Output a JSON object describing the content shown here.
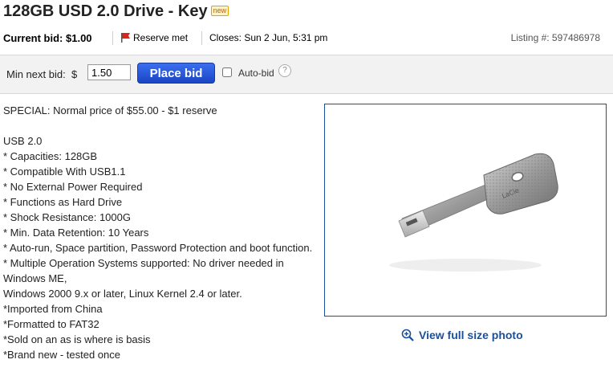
{
  "title": "128GB USD 2.0 Drive - Key",
  "new_badge": "new",
  "current_bid": "Current bid: $1.00",
  "reserve_status": "Reserve met",
  "closes": "Closes: Sun 2 Jun, 5:31 pm",
  "listing": "Listing #: 597486978",
  "bid_bar": {
    "min_next_bid_label": "Min next bid:",
    "currency": "$",
    "bid_value": "1.50",
    "place_bid_label": "Place bid",
    "autobid_label": "Auto-bid",
    "help_icon": "?"
  },
  "description": [
    "SPECIAL: Normal price of $55.00 - $1 reserve",
    "",
    "USB 2.0",
    "* Capacities: 128GB",
    "* Compatible With USB1.1",
    "* No External Power Required",
    "* Functions as Hard Drive",
    "* Shock Resistance: 1000G",
    "* Min. Data Retention: 10 Years",
    "* Auto-run, Space partition, Password Protection and boot function.",
    "* Multiple Operation Systems supported: No driver needed in Windows ME,",
    "Windows 2000 9.x or later, Linux Kernel 2.4 or later.",
    "*Imported from China",
    "*Formatted to FAT32",
    "*Sold on an as is where is basis",
    "*Brand new - tested once"
  ],
  "view_photo_label": "View full size photo",
  "colors": {
    "link": "#1a4f9c",
    "button": "#1b45c4",
    "flag": "#d9261c"
  }
}
